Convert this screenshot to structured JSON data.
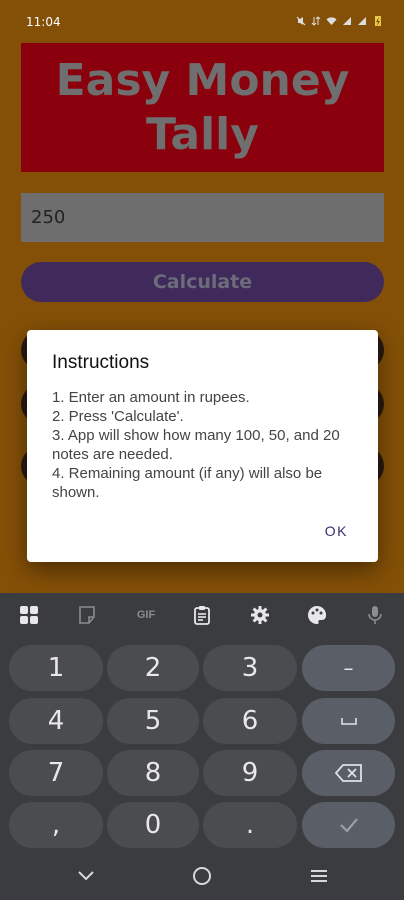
{
  "status_bar": {
    "time": "11:04",
    "icons": [
      "mute-icon",
      "data-icon",
      "wifi-icon",
      "signal-icon",
      "signal-icon-2",
      "battery-charging-icon"
    ]
  },
  "app": {
    "title": "Easy Money Tally",
    "amount_value": "250",
    "calculate_label": "Calculate",
    "background_color": "#845007",
    "title_box_color": "#8a000c",
    "button_color": "#3f2a5b"
  },
  "dialog": {
    "title": "Instructions",
    "lines": [
      "1. Enter an amount in rupees.",
      "2. Press 'Calculate'.",
      "3. App will show how many 100, 50, and 20 notes are needed.",
      "4. Remaining amount (if any) will also be shown."
    ],
    "ok_label": "OK"
  },
  "keyboard": {
    "toolbar_icons": [
      "apps-grid-icon",
      "sticker-icon",
      "gif-icon",
      "clipboard-icon",
      "settings-gear-icon",
      "palette-icon",
      "microphone-icon"
    ],
    "gif_label": "GIF",
    "keys": {
      "k1": "1",
      "k2": "2",
      "k3": "3",
      "minus": "–",
      "k4": "4",
      "k5": "5",
      "k6": "6",
      "k7": "7",
      "k8": "8",
      "k9": "9",
      "comma": ",",
      "k0": "0",
      "period": "."
    }
  },
  "nav_bar": {
    "icons": [
      "back-chevron-icon",
      "home-circle-icon",
      "recents-menu-icon"
    ]
  }
}
